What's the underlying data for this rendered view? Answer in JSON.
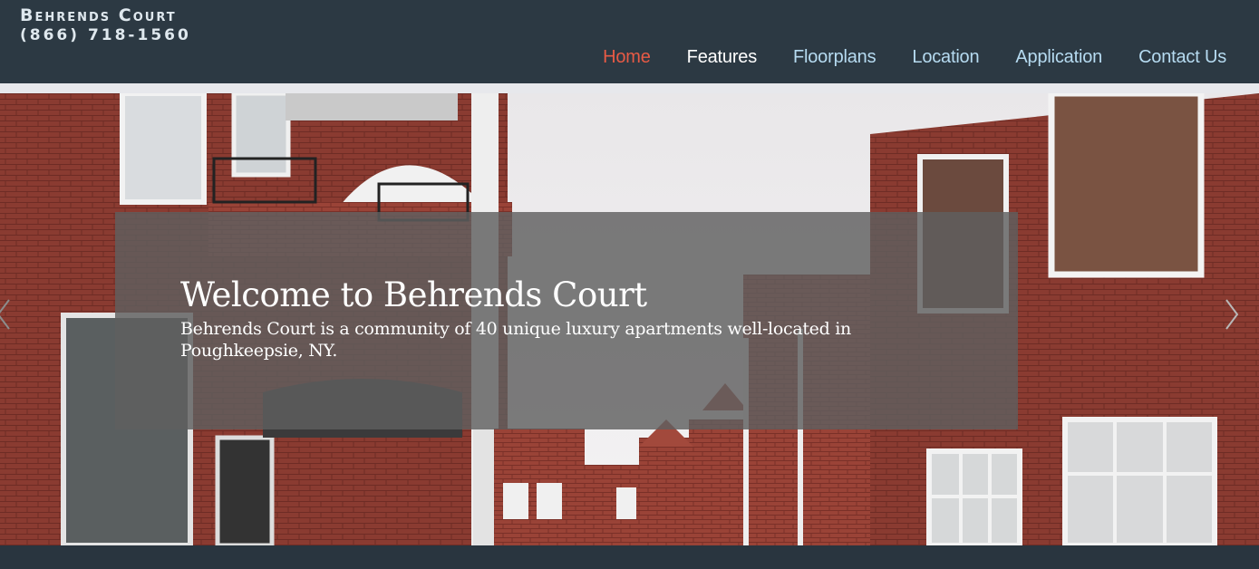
{
  "header": {
    "brand_name": "Behrends Court",
    "phone": "(866) 718-1560"
  },
  "nav": {
    "items": [
      {
        "label": "Home",
        "active": true
      },
      {
        "label": "Features"
      },
      {
        "label": "Floorplans"
      },
      {
        "label": "Location"
      },
      {
        "label": "Application"
      },
      {
        "label": "Contact Us"
      }
    ]
  },
  "hero": {
    "title": "Welcome to Behrends Court",
    "text": "Behrends Court is a community of 40 unique luxury apartments well-located in Poughkeepsie, NY.",
    "prev_icon": "chevron-left-icon",
    "next_icon": "chevron-right-icon"
  },
  "colors": {
    "header_bg": "#2c3943",
    "nav_link": "#b6dbf1",
    "nav_active": "#e75a45",
    "brick": "#8b3a30"
  }
}
